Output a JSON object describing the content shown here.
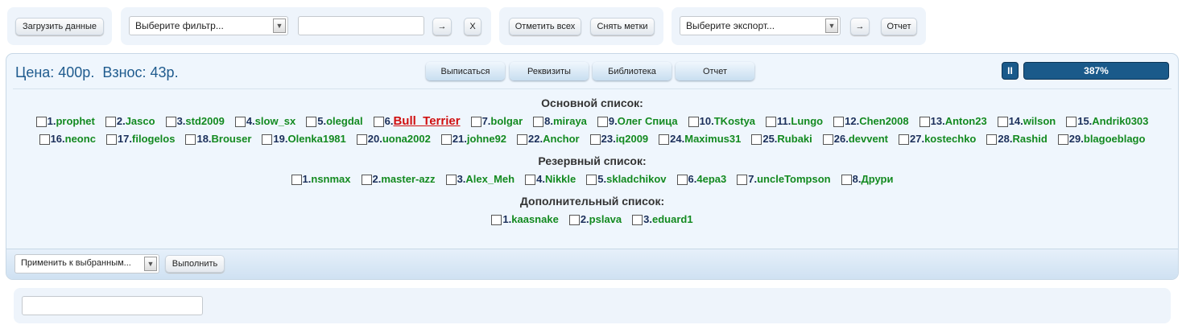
{
  "toolbar": {
    "load": "Загрузить данные",
    "filter_select": "Выберите фильтр...",
    "filter_value": "",
    "go": "→",
    "clear": "X",
    "mark_all": "Отметить всех",
    "unmark": "Снять метки",
    "export_select": "Выберите экспорт...",
    "export_go": "→",
    "report": "Отчет"
  },
  "header": {
    "title": "Цена: 400р.  Взнос: 43р.",
    "buttons": [
      "Выписаться",
      "Реквизиты",
      "Библиотека",
      "Отчет"
    ],
    "pause_icon": "pause-icon",
    "pause": "II",
    "progress_text": "387%",
    "progress_value": 387,
    "accent": "#1a5a8a"
  },
  "lists": [
    {
      "title": "Основной список:",
      "rows": [
        [
          {
            "n": "1.",
            "name": "prophet"
          },
          {
            "n": "2.",
            "name": "Jasco"
          },
          {
            "n": "3.",
            "name": "std2009"
          },
          {
            "n": "4.",
            "name": "slow_sx"
          },
          {
            "n": "5.",
            "name": "olegdal"
          },
          {
            "n": "6.",
            "name": "Bull_Terrier",
            "highlight": true
          },
          {
            "n": "7.",
            "name": "bolgar"
          },
          {
            "n": "8.",
            "name": "miraya"
          },
          {
            "n": "9.",
            "name": "Олег Спица"
          },
          {
            "n": "10.",
            "name": "TKostya"
          },
          {
            "n": "11.",
            "name": "Lungo"
          },
          {
            "n": "12.",
            "name": "Chen2008"
          },
          {
            "n": "13.",
            "name": "Anton23"
          },
          {
            "n": "14.",
            "name": "wilson"
          },
          {
            "n": "15.",
            "name": "Andrik0303"
          }
        ],
        [
          {
            "n": "16.",
            "name": "neonc"
          },
          {
            "n": "17.",
            "name": "filogelos"
          },
          {
            "n": "18.",
            "name": "Brouser"
          },
          {
            "n": "19.",
            "name": "Olenka1981"
          },
          {
            "n": "20.",
            "name": "uona2002"
          },
          {
            "n": "21.",
            "name": "johne92"
          },
          {
            "n": "22.",
            "name": "Anchor"
          },
          {
            "n": "23.",
            "name": "iq2009"
          },
          {
            "n": "24.",
            "name": "Maximus31"
          },
          {
            "n": "25.",
            "name": "Rubaki"
          },
          {
            "n": "26.",
            "name": "devvent"
          },
          {
            "n": "27.",
            "name": "kostechko"
          },
          {
            "n": "28.",
            "name": "Rashid"
          },
          {
            "n": "29.",
            "name": "blagoeblago"
          }
        ]
      ]
    },
    {
      "title": "Резервный список:",
      "rows": [
        [
          {
            "n": "1.",
            "name": "nsnmax"
          },
          {
            "n": "2.",
            "name": "master-azz"
          },
          {
            "n": "3.",
            "name": "Alex_Meh"
          },
          {
            "n": "4.",
            "name": "Nikkle"
          },
          {
            "n": "5.",
            "name": "skladchikov"
          },
          {
            "n": "6.",
            "name": "4epa3"
          },
          {
            "n": "7.",
            "name": "uncleTompson"
          },
          {
            "n": "8.",
            "name": "Друри"
          }
        ]
      ]
    },
    {
      "title": "Дополнительный список:",
      "rows": [
        [
          {
            "n": "1.",
            "name": "kaasnake"
          },
          {
            "n": "2.",
            "name": "pslava"
          },
          {
            "n": "3.",
            "name": "eduard1"
          }
        ]
      ]
    }
  ],
  "footer": {
    "action_select": "Применить к выбранным...",
    "execute": "Выполнить"
  },
  "bottom": {
    "input_value": ""
  }
}
